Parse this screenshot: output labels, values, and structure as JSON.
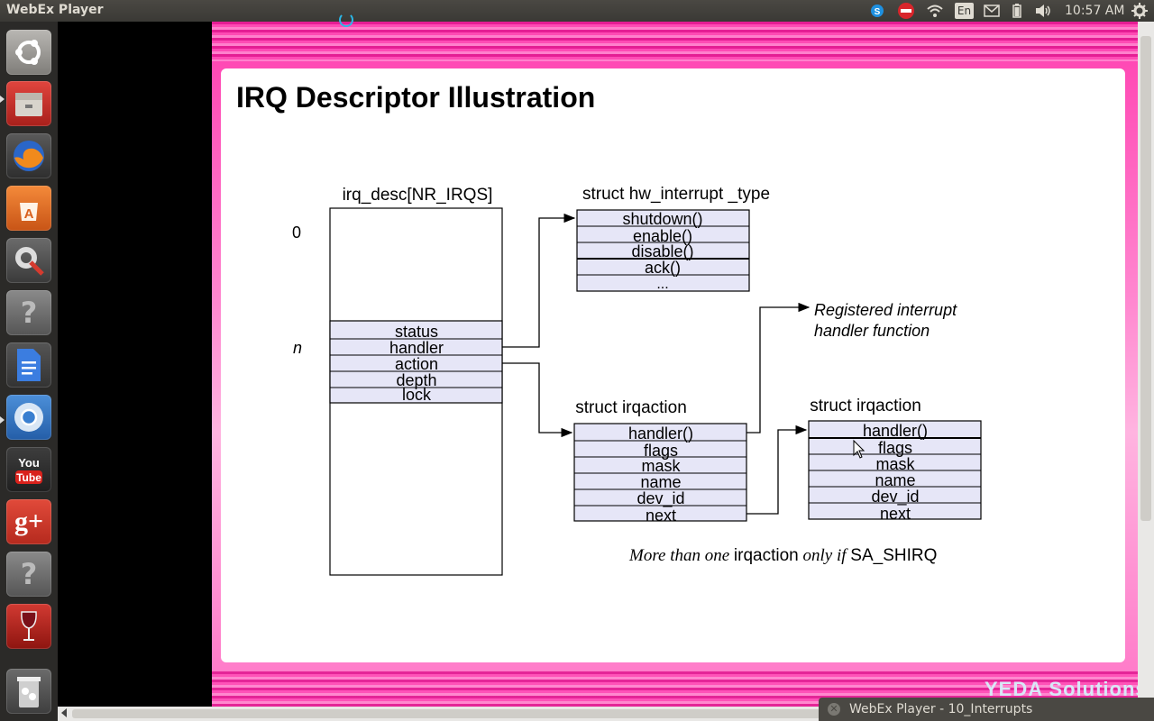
{
  "topbar": {
    "app_title": "WebEx Player",
    "keyboard_layout": "En",
    "clock": "10:57 AM",
    "tray_icons": [
      "skype-icon",
      "no-entry-icon",
      "wifi-icon",
      "keyboard-layout-icon",
      "mail-icon",
      "battery-icon",
      "volume-icon",
      "gear-icon"
    ]
  },
  "launcher": {
    "items": [
      "ubuntu-dash",
      "files",
      "firefox",
      "software-center",
      "system-settings",
      "unknown-app",
      "google-docs",
      "chromium",
      "youtube",
      "google-plus",
      "unknown-app-2",
      "wine",
      "trash"
    ]
  },
  "slide": {
    "title": "IRQ Descriptor Illustration",
    "logo": "YEDA Solutions"
  },
  "diagram": {
    "irq_desc_label": "irq_desc[NR_IRQS]",
    "index_zero": "0",
    "index_n": "n",
    "desc_fields": [
      "status",
      "handler",
      "action",
      "depth",
      "lock"
    ],
    "hw_type_label": "struct hw_interrupt _type",
    "hw_fields": [
      "shutdown()",
      "enable()",
      "disable()",
      "ack()",
      "..."
    ],
    "registered_label_line1": "Registered interrupt",
    "registered_label_line2": "handler function",
    "irqaction1_label": "struct irqaction",
    "irqaction2_label": "struct irqaction",
    "irqaction_fields": [
      "handler()",
      "flags",
      "mask",
      "name",
      "dev_id",
      "next"
    ],
    "footnote_italic": "More than one ",
    "footnote_mid": "irqaction",
    "footnote_italic2": " only if ",
    "footnote_end": "SA_SHIRQ"
  },
  "taskbar": {
    "title": "WebEx Player - 10_Interrupts"
  }
}
